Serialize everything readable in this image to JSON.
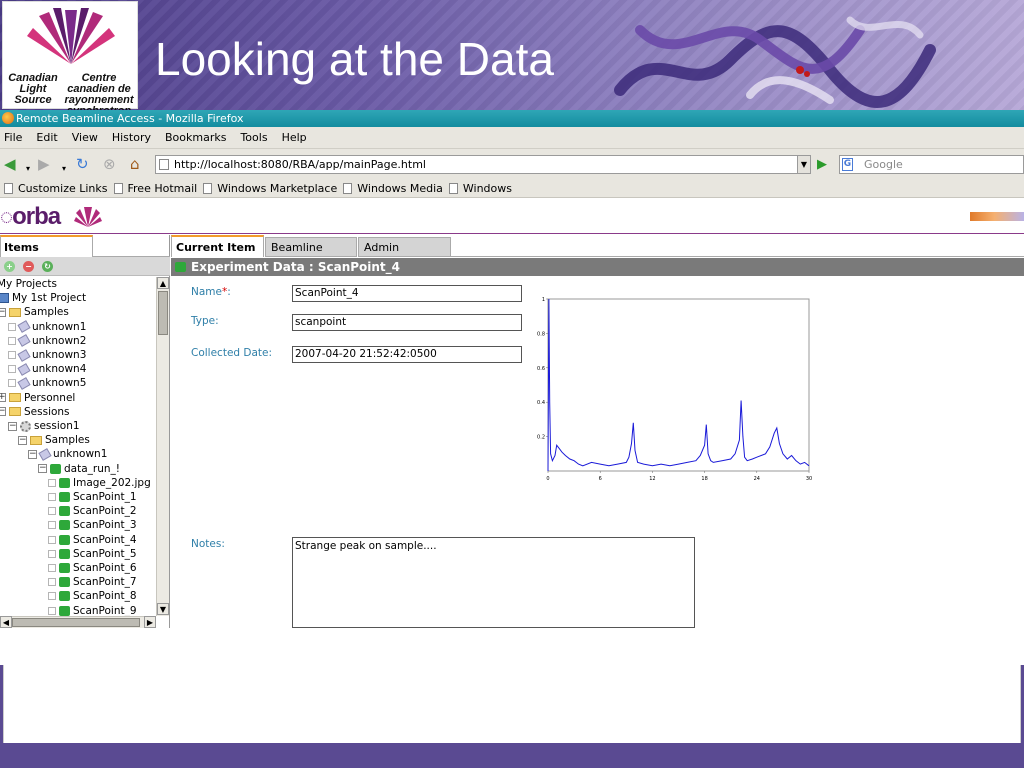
{
  "slide": {
    "title": "Looking at the Data",
    "logo": {
      "en": "Canadian Light Source",
      "fr": "Centre canadien de rayonnement synchrotron"
    }
  },
  "window": {
    "title": "Remote Beamline Access - Mozilla Firefox"
  },
  "menu": [
    "File",
    "Edit",
    "View",
    "History",
    "Bookmarks",
    "Tools",
    "Help"
  ],
  "nav": {
    "url": "http://localhost:8080/RBA/app/mainPage.html",
    "search_placeholder": "Google"
  },
  "bookmarks": [
    "Customize Links",
    "Free Hotmail",
    "Windows Marketplace",
    "Windows Media",
    "Windows"
  ],
  "app": {
    "brand": "orba",
    "left_tab": "Items",
    "tree": [
      {
        "label": "My Projects",
        "depth": 0,
        "icon": "none",
        "expander": ""
      },
      {
        "label": "My 1st Project",
        "depth": 0,
        "icon": "book",
        "expander": ""
      },
      {
        "label": "Samples",
        "depth": 0,
        "icon": "folder",
        "expander": "−"
      },
      {
        "label": "unknown1",
        "depth": 1,
        "icon": "tag",
        "expander": "chk"
      },
      {
        "label": "unknown2",
        "depth": 1,
        "icon": "tag",
        "expander": "chk"
      },
      {
        "label": "unknown3",
        "depth": 1,
        "icon": "tag",
        "expander": "chk"
      },
      {
        "label": "unknown4",
        "depth": 1,
        "icon": "tag",
        "expander": "chk"
      },
      {
        "label": "unknown5",
        "depth": 1,
        "icon": "tag",
        "expander": "chk"
      },
      {
        "label": "Personnel",
        "depth": 0,
        "icon": "folder",
        "expander": "+"
      },
      {
        "label": "Sessions",
        "depth": 0,
        "icon": "folder",
        "expander": "−"
      },
      {
        "label": "session1",
        "depth": 1,
        "icon": "gear",
        "expander": "−"
      },
      {
        "label": "Samples",
        "depth": 2,
        "icon": "folder",
        "expander": "−"
      },
      {
        "label": "unknown1",
        "depth": 3,
        "icon": "tag",
        "expander": "−"
      },
      {
        "label": "data_run_!",
        "depth": 4,
        "icon": "puzzle",
        "expander": "−"
      },
      {
        "label": "Image_202.jpg",
        "depth": 5,
        "icon": "puzzle",
        "expander": "chk"
      },
      {
        "label": "ScanPoint_1",
        "depth": 5,
        "icon": "puzzle",
        "expander": "chk"
      },
      {
        "label": "ScanPoint_2",
        "depth": 5,
        "icon": "puzzle",
        "expander": "chk"
      },
      {
        "label": "ScanPoint_3",
        "depth": 5,
        "icon": "puzzle",
        "expander": "chk"
      },
      {
        "label": "ScanPoint_4",
        "depth": 5,
        "icon": "puzzle",
        "expander": "chk"
      },
      {
        "label": "ScanPoint_5",
        "depth": 5,
        "icon": "puzzle",
        "expander": "chk"
      },
      {
        "label": "ScanPoint_6",
        "depth": 5,
        "icon": "puzzle",
        "expander": "chk"
      },
      {
        "label": "ScanPoint_7",
        "depth": 5,
        "icon": "puzzle",
        "expander": "chk"
      },
      {
        "label": "ScanPoint_8",
        "depth": 5,
        "icon": "puzzle",
        "expander": "chk"
      },
      {
        "label": "ScanPoint_9",
        "depth": 5,
        "icon": "puzzle",
        "expander": "chk"
      }
    ],
    "right_tabs": [
      "Current Item",
      "Beamline",
      "Admin"
    ],
    "header": "Experiment Data : ScanPoint_4",
    "form": {
      "name_label": "Name",
      "required_mark": "*",
      "name_colon": ":",
      "name_value": "ScanPoint_4",
      "type_label": "Type:",
      "type_value": "scanpoint",
      "date_label": "Collected Date:",
      "date_value": "2007-04-20 21:52:42:0500",
      "notes_label": "Notes:",
      "notes_value": "Strange peak on sample...."
    }
  },
  "chart_data": {
    "type": "line",
    "color": "#1a1ad8",
    "xlim": [
      0,
      30
    ],
    "ylim": [
      0,
      1
    ],
    "xticks": [
      "0",
      "6",
      "12",
      "18",
      "24",
      "30"
    ],
    "yticks": [
      "0.2",
      "0.4",
      "0.6",
      "0.8",
      "1"
    ],
    "series": [
      {
        "x": [
          0,
          0.1,
          0.2,
          0.3,
          0.5,
          0.8,
          1.0,
          1.3,
          1.6,
          2.0,
          2.5,
          3.0,
          3.5,
          4.0,
          5.0,
          6.0,
          7.0,
          8.0,
          9.0,
          9.3,
          9.6,
          9.8,
          10.0,
          10.3,
          11.0,
          12.0,
          13.0,
          14.0,
          15.0,
          16.0,
          17.0,
          17.5,
          18.0,
          18.2,
          18.4,
          18.7,
          19.0,
          20.0,
          21.0,
          21.5,
          22.0,
          22.2,
          22.4,
          22.6,
          22.9,
          23.5,
          24.0,
          25.0,
          25.5,
          26.0,
          26.3,
          26.6,
          27.0,
          27.5,
          28.0,
          28.5,
          29.0,
          29.5,
          30.0
        ],
        "y": [
          0.0,
          1.0,
          0.4,
          0.1,
          0.06,
          0.09,
          0.15,
          0.13,
          0.11,
          0.09,
          0.07,
          0.06,
          0.04,
          0.03,
          0.05,
          0.04,
          0.03,
          0.04,
          0.05,
          0.08,
          0.16,
          0.28,
          0.12,
          0.05,
          0.04,
          0.03,
          0.04,
          0.03,
          0.04,
          0.05,
          0.06,
          0.09,
          0.15,
          0.27,
          0.1,
          0.06,
          0.05,
          0.06,
          0.07,
          0.1,
          0.18,
          0.41,
          0.2,
          0.08,
          0.06,
          0.07,
          0.08,
          0.1,
          0.14,
          0.22,
          0.25,
          0.16,
          0.1,
          0.07,
          0.09,
          0.06,
          0.04,
          0.05,
          0.03
        ]
      }
    ]
  }
}
